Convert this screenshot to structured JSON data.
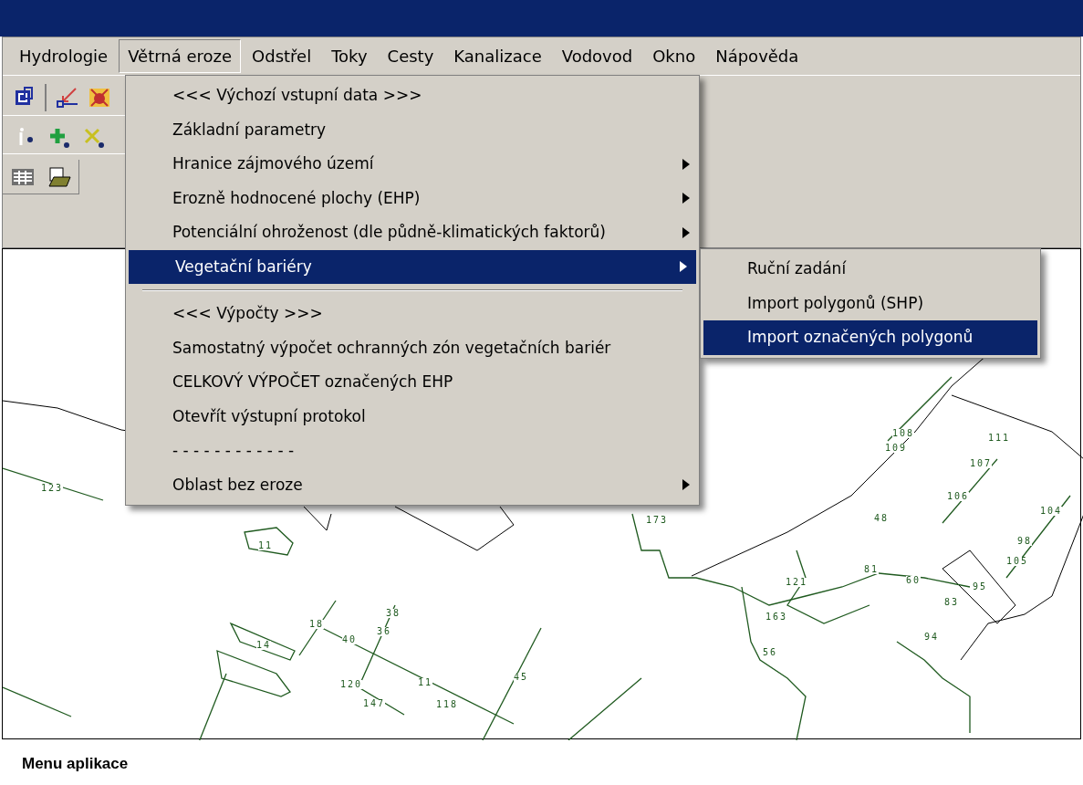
{
  "menu_bar": [
    {
      "label": "Hydrologie",
      "selected": false
    },
    {
      "label": "Větrná eroze",
      "selected": true
    },
    {
      "label": "Odstřel",
      "selected": false
    },
    {
      "label": "Toky",
      "selected": false
    },
    {
      "label": "Cesty",
      "selected": false
    },
    {
      "label": "Kanalizace",
      "selected": false
    },
    {
      "label": "Vodovod",
      "selected": false
    },
    {
      "label": "Okno",
      "selected": false
    },
    {
      "label": "Nápověda",
      "selected": false
    }
  ],
  "dropdown": [
    {
      "kind": "item",
      "label": "<<< Výchozí vstupní data >>>",
      "submenu": false,
      "selected": false
    },
    {
      "kind": "item",
      "label": "Základní parametry",
      "submenu": false,
      "selected": false
    },
    {
      "kind": "item",
      "label": "Hranice zájmového území",
      "submenu": true,
      "selected": false
    },
    {
      "kind": "item",
      "label": "Erozně hodnocené plochy (EHP)",
      "submenu": true,
      "selected": false
    },
    {
      "kind": "item",
      "label": "Potenciální ohroženost (dle půdně-klimatických faktorů)",
      "submenu": true,
      "selected": false
    },
    {
      "kind": "item",
      "label": "Vegetační bariéry",
      "submenu": true,
      "selected": true
    },
    {
      "kind": "separator"
    },
    {
      "kind": "item",
      "label": "<<< Výpočty >>>",
      "submenu": false,
      "selected": false
    },
    {
      "kind": "item",
      "label": "Samostatný výpočet ochranných zón vegetačních bariér",
      "submenu": false,
      "selected": false
    },
    {
      "kind": "item",
      "label": "CELKOVÝ VÝPOČET označených EHP",
      "submenu": false,
      "selected": false
    },
    {
      "kind": "item",
      "label": "Otevřít výstupní protokol",
      "submenu": false,
      "selected": false
    },
    {
      "kind": "item",
      "label": "- - - - - - - - - - - -",
      "submenu": false,
      "selected": false
    },
    {
      "kind": "item",
      "label": "Oblast bez eroze",
      "submenu": true,
      "selected": false
    }
  ],
  "submenu": [
    {
      "label": "Ruční zadání",
      "selected": false
    },
    {
      "label": "Import polygonů (SHP)",
      "selected": false
    },
    {
      "label": "Import označených polygonů",
      "selected": true
    }
  ],
  "map_labels": [
    "123",
    "11",
    "14",
    "18",
    "40",
    "36",
    "38",
    "120",
    "147",
    "11",
    "45",
    "118",
    "173",
    "108",
    "109",
    "107",
    "106",
    "111",
    "104",
    "98",
    "105",
    "95",
    "83",
    "94",
    "48",
    "60",
    "81",
    "121",
    "163",
    "56"
  ],
  "caption": "Menu aplikace"
}
